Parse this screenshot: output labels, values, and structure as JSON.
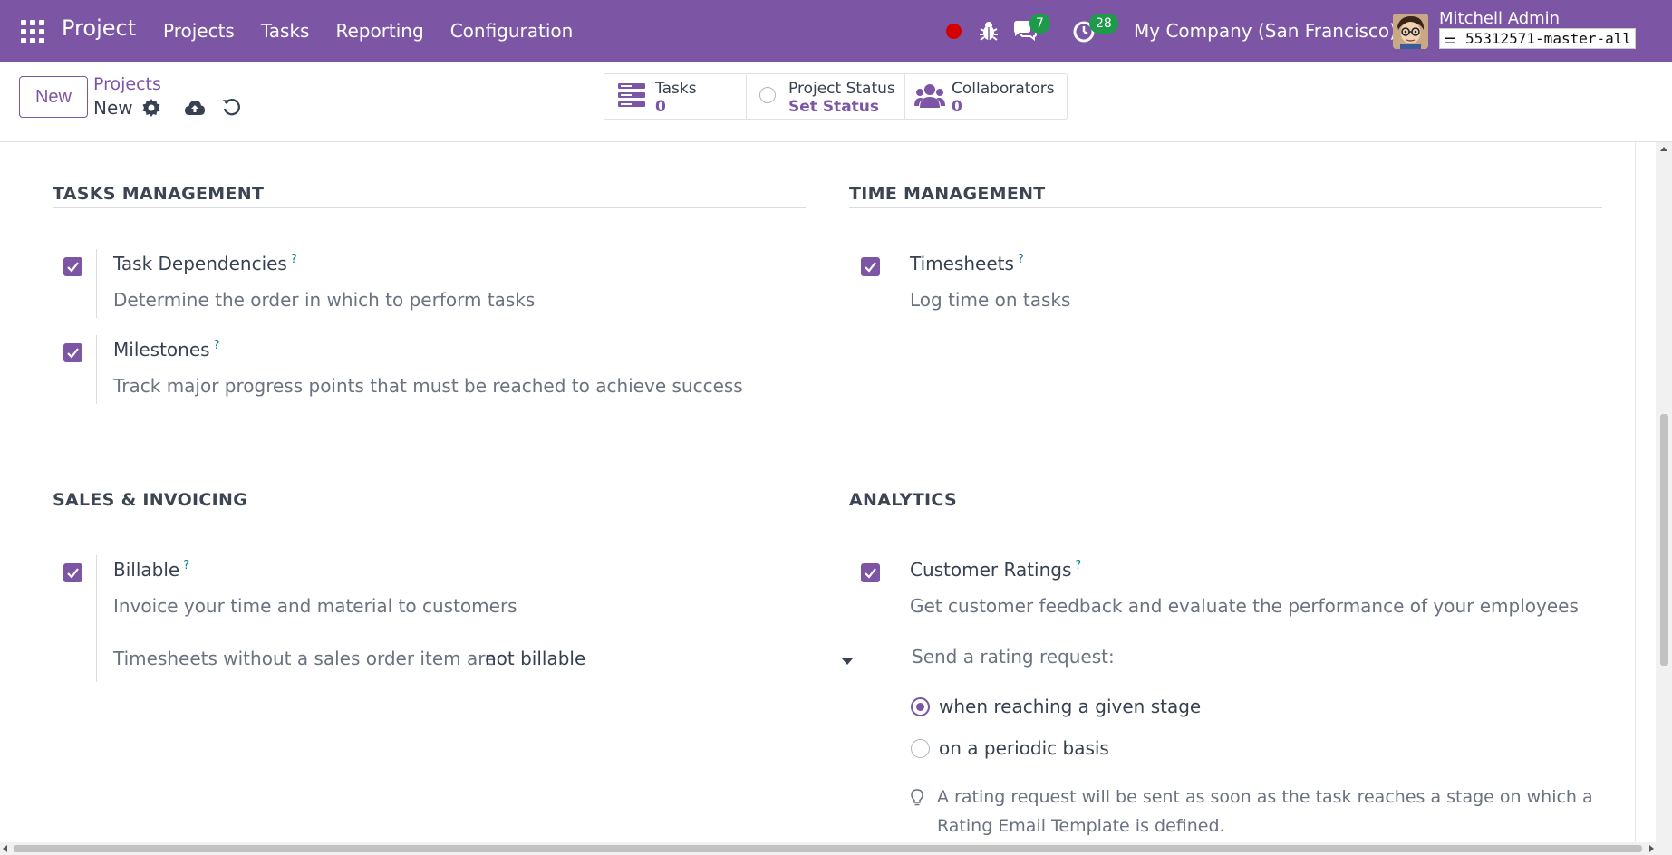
{
  "navbar": {
    "app_title": "Project",
    "menu": [
      "Projects",
      "Tasks",
      "Reporting",
      "Configuration"
    ],
    "chat_count": "7",
    "activity_count": "28",
    "company": "My Company (San Francisco)",
    "user_name": "Mitchell Admin",
    "database": "55312571-master-all"
  },
  "control_panel": {
    "new_label": "New",
    "breadcrumb_parent": "Projects",
    "breadcrumb_current": "New",
    "smart_buttons": {
      "tasks": {
        "label": "Tasks",
        "value": "0"
      },
      "status": {
        "label": "Project Status",
        "value": "Set Status"
      },
      "collaborators": {
        "label": "Collaborators",
        "value": "0"
      }
    }
  },
  "sections": {
    "tasks_management": {
      "title": "TASKS MANAGEMENT",
      "settings": [
        {
          "title": "Task Dependencies",
          "help": "?",
          "description": "Determine the order in which to perform tasks",
          "checked": true
        },
        {
          "title": "Milestones",
          "help": "?",
          "description": "Track major progress points that must be reached to achieve success",
          "checked": true
        }
      ]
    },
    "time_management": {
      "title": "TIME MANAGEMENT",
      "settings": [
        {
          "title": "Timesheets",
          "help": "?",
          "description": "Log time on tasks",
          "checked": true
        }
      ]
    },
    "sales_invoicing": {
      "title": "SALES & INVOICING",
      "settings": [
        {
          "title": "Billable",
          "help": "?",
          "description": "Invoice your time and material to customers",
          "checked": true
        }
      ],
      "select_label": "Timesheets without a sales order item are",
      "select_value": "not billable"
    },
    "analytics": {
      "title": "ANALYTICS",
      "settings": [
        {
          "title": "Customer Ratings",
          "help": "?",
          "description": "Get customer feedback and evaluate the performance of your employees",
          "checked": true
        }
      ],
      "rating_label": "Send a rating request:",
      "options": [
        {
          "label": "when reaching a given stage",
          "selected": true
        },
        {
          "label": "on a periodic basis",
          "selected": false
        }
      ],
      "hint": "A rating request will be sent as soon as the task reaches a stage on which a Rating Email Template is defined."
    }
  },
  "colors": {
    "brand": "#7c55a5",
    "badge": "#1e9b4a",
    "recording": "#d40000",
    "help": "#017e84"
  }
}
